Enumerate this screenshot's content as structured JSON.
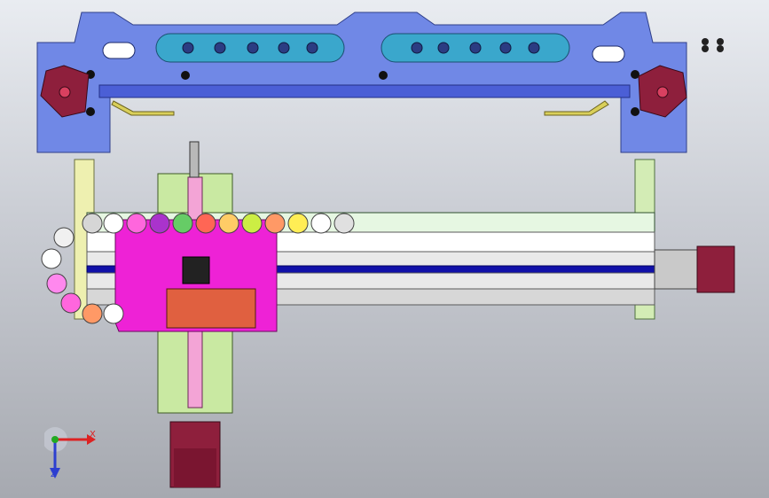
{
  "viewport": {
    "background": "gradient-gray",
    "triad": {
      "x_label": "X",
      "z_label": "Z",
      "x_color": "#d22222",
      "y_color": "#22aa22",
      "z_color": "#2d3fd0"
    }
  },
  "model": {
    "frame_color": "#6f86e6",
    "motor_color": "#8e1f3c",
    "carriage_color": "#ee22d6",
    "rail_color": "#e9f0e6",
    "spindle_color": "#c9e9a2",
    "cable_chain_colors": [
      "#d6d6d6",
      "#ff66dd",
      "#aa33cc",
      "#66cc66",
      "#ff6655",
      "#ffcc66",
      "#ccee44",
      "#ff9966",
      "#ffee55",
      "#ffffff"
    ]
  }
}
